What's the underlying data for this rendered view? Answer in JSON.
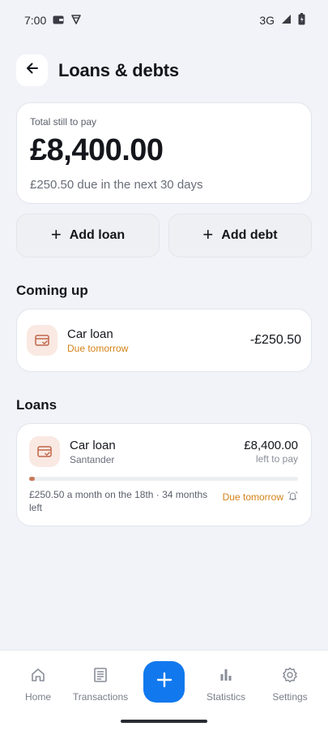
{
  "status_bar": {
    "time": "7:00",
    "network": "3G"
  },
  "header": {
    "title": "Loans & debts"
  },
  "summary": {
    "label": "Total still to pay",
    "amount": "£8,400.00",
    "due_text": "£250.50 due in the next 30 days"
  },
  "actions": {
    "add_loan": "Add loan",
    "add_debt": "Add debt",
    "plus": "+"
  },
  "coming_up": {
    "title": "Coming up",
    "item": {
      "name": "Car loan",
      "status": "Due tomorrow",
      "amount": "-£250.50"
    }
  },
  "loans": {
    "title": "Loans",
    "item": {
      "name": "Car loan",
      "lender": "Santander",
      "amount": "£8,400.00",
      "amount_caption": "left to pay",
      "progress_fraction": 0.02,
      "schedule": "£250.50 a month on the 18th · 34 months left",
      "due": "Due tomorrow"
    }
  },
  "bottom_nav": {
    "home": "Home",
    "transactions": "Transactions",
    "statistics": "Statistics",
    "settings": "Settings"
  },
  "colors": {
    "accent": "#1178ee",
    "warning": "#d4831a",
    "icon_bg": "#f9e9e2",
    "icon_fg": "#c0664a"
  }
}
